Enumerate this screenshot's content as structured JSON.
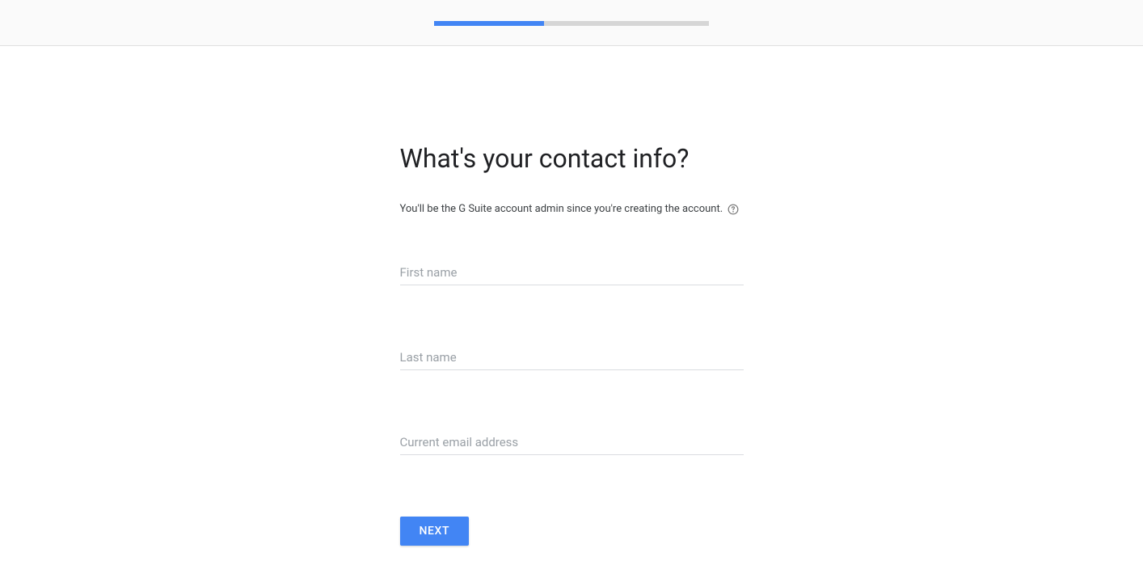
{
  "progress": {
    "percent": 40
  },
  "form": {
    "heading": "What's your contact info?",
    "subtitle": "You'll be the G Suite account admin since you're creating the account.",
    "fields": {
      "first_name": {
        "placeholder": "First name",
        "value": ""
      },
      "last_name": {
        "placeholder": "Last name",
        "value": ""
      },
      "email": {
        "placeholder": "Current email address",
        "value": ""
      }
    },
    "next_button": "NEXT"
  }
}
